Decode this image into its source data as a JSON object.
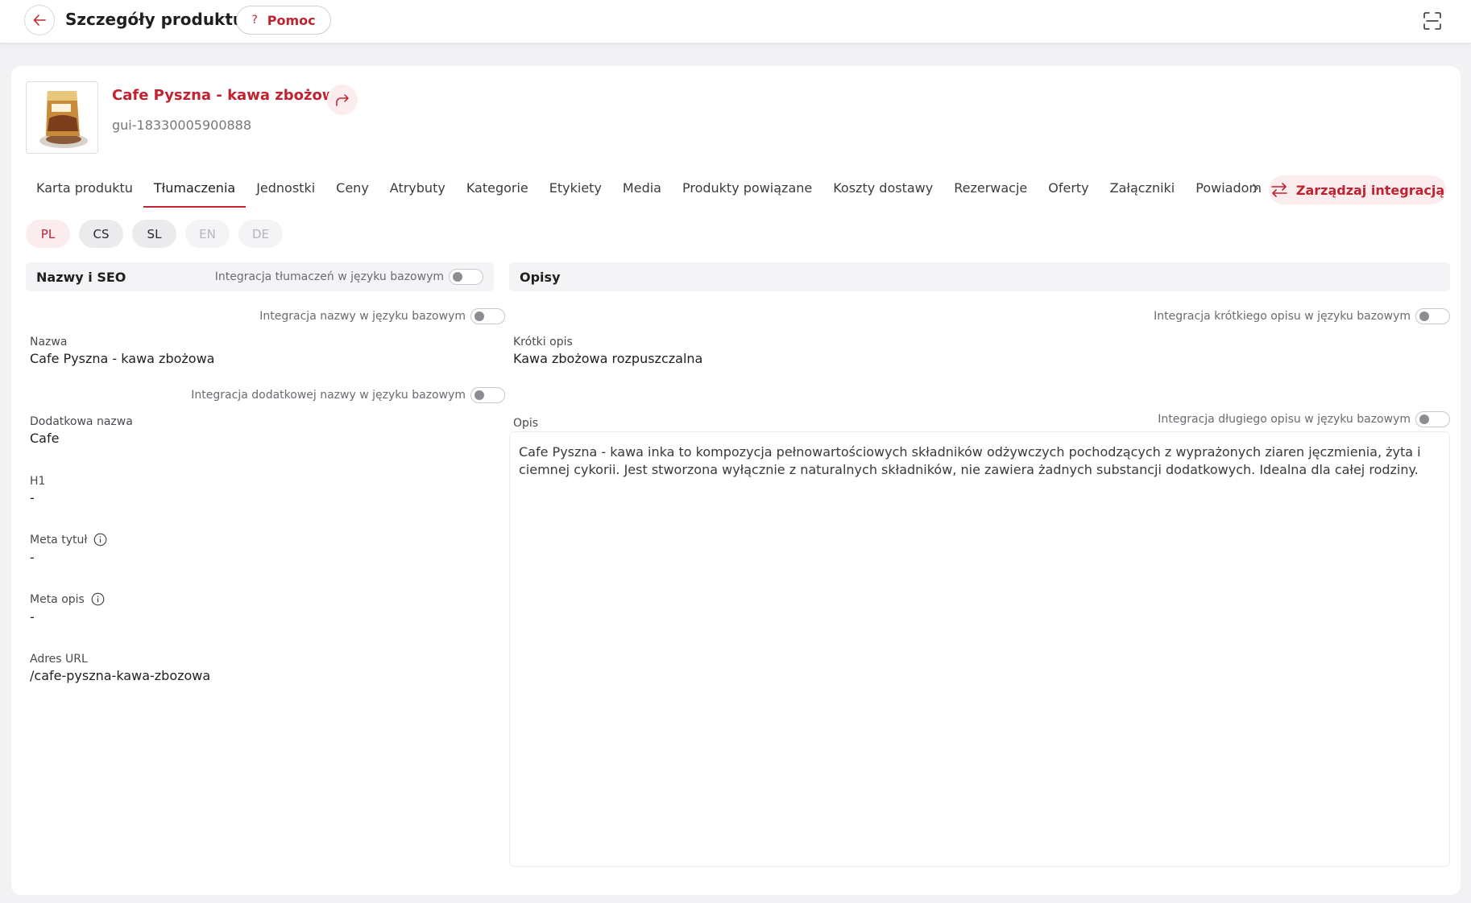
{
  "header": {
    "title": "Szczegóły produktu",
    "help_label": "Pomoc",
    "help_icon_glyph": "?"
  },
  "product": {
    "name": "Cafe Pyszna - kawa zbożowa",
    "id": "gui-18330005900888"
  },
  "tabs": [
    {
      "label": "Karta produktu",
      "active": false
    },
    {
      "label": "Tłumaczenia",
      "active": true
    },
    {
      "label": "Jednostki",
      "active": false
    },
    {
      "label": "Ceny",
      "active": false
    },
    {
      "label": "Atrybuty",
      "active": false
    },
    {
      "label": "Kategorie",
      "active": false
    },
    {
      "label": "Etykiety",
      "active": false
    },
    {
      "label": "Media",
      "active": false
    },
    {
      "label": "Produkty powiązane",
      "active": false
    },
    {
      "label": "Koszty dostawy",
      "active": false
    },
    {
      "label": "Rezerwacje",
      "active": false
    },
    {
      "label": "Oferty",
      "active": false
    },
    {
      "label": "Załączniki",
      "active": false
    },
    {
      "label": "Powiadom",
      "active": false
    }
  ],
  "manage_integration_label": "Zarządzaj integracją",
  "languages": [
    {
      "code": "PL",
      "state": "active"
    },
    {
      "code": "CS",
      "state": "normal"
    },
    {
      "code": "SL",
      "state": "normal"
    },
    {
      "code": "EN",
      "state": "disabled"
    },
    {
      "code": "DE",
      "state": "disabled"
    }
  ],
  "names_seo": {
    "title": "Nazwy i SEO",
    "toggle_translations": "Integracja tłumaczeń w języku bazowym",
    "toggle_name": "Integracja nazwy w języku bazowym",
    "toggle_additional_name": "Integracja dodatkowej nazwy w języku bazowym",
    "fields": {
      "name_label": "Nazwa",
      "name_value": "Cafe Pyszna - kawa zbożowa",
      "additional_name_label": "Dodatkowa nazwa",
      "additional_name_value": "Cafe",
      "h1_label": "H1",
      "h1_value": "-",
      "meta_title_label": "Meta tytuł",
      "meta_title_value": "-",
      "meta_desc_label": "Meta opis",
      "meta_desc_value": "-",
      "url_label": "Adres URL",
      "url_value": "/cafe-pyszna-kawa-zbozowa"
    }
  },
  "descriptions": {
    "title": "Opisy",
    "toggle_short": "Integracja krótkiego opisu w języku bazowym",
    "toggle_long": "Integracja długiego opisu w języku bazowym",
    "short_label": "Krótki opis",
    "short_value": "Kawa zbożowa rozpuszczalna",
    "long_label": "Opis",
    "long_value": "Cafe Pyszna - kawa inka to kompozycja pełnowartościowych składników odżywczych pochodzących z wyprażonych ziaren jęczmienia, żyta i ciemnej cykorii. Jest stworzona wyłącznie z naturalnych składników, nie zawiera żadnych substancji dodatkowych. Idealna dla całej rodziny."
  },
  "colors": {
    "accent": "#c0232f",
    "accent_soft": "#fbecee"
  }
}
